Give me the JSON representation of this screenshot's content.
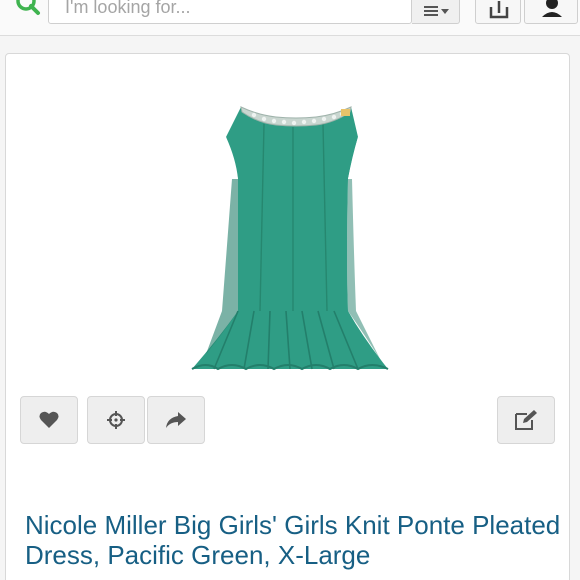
{
  "header": {
    "search": {
      "placeholder": "I'm looking for..."
    },
    "icons": {
      "search_logo": "magnifier-logo-icon",
      "filter": "menu-dropdown-icon",
      "share": "share-upload-icon",
      "profile": "person-icon"
    }
  },
  "listing": {
    "title": "Nicole Miller Big Girls' Girls Knit Ponte Pleated Dress, Pacific Green, X-Large",
    "image_description_colors": {
      "dress": "#2f9d85",
      "dress_shadow": "#237f6b",
      "collar_jewels": "#c9d6d0"
    },
    "actions": {
      "like": "heart-icon",
      "bundle": "crosshair-icon",
      "share": "share-arrow-icon",
      "edit": "edit-icon"
    }
  },
  "colors": {
    "title": "#175f84",
    "logo_green": "#3fb34f",
    "icon_gray": "#555555"
  }
}
